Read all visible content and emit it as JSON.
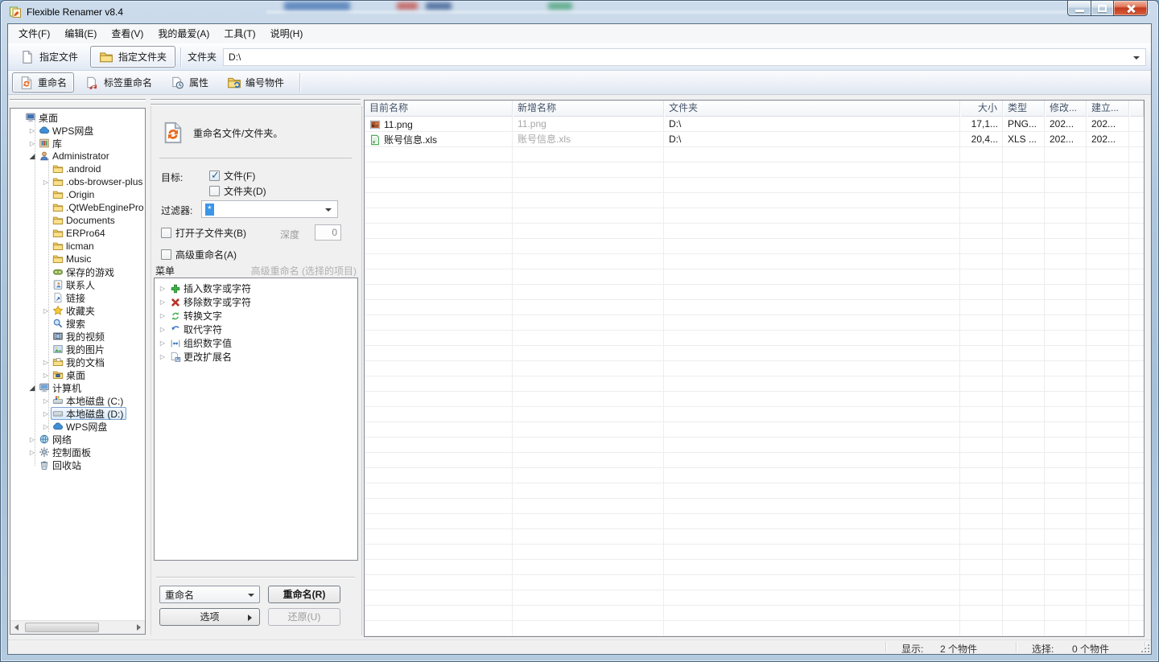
{
  "colors": {
    "titlebar": "#b7cde2",
    "selection_border": "#7da2ce",
    "selection_fill": "#d7e9fa",
    "header_text": "#44546a",
    "muted_text": "#a8a8a8",
    "filter_highlight": "#3b95e8"
  },
  "window": {
    "title": "Flexible Renamer v8.4",
    "controls": [
      {
        "name": "minimize",
        "label": "minimize"
      },
      {
        "name": "maximize",
        "label": "maximize"
      },
      {
        "name": "close",
        "label": "close"
      }
    ]
  },
  "menu_bar": {
    "items": [
      {
        "name": "file",
        "label": "文件(F)"
      },
      {
        "name": "edit",
        "label": "编辑(E)"
      },
      {
        "name": "view",
        "label": "查看(V)"
      },
      {
        "name": "favorites",
        "label": "我的最爱(A)"
      },
      {
        "name": "tools",
        "label": "工具(T)"
      },
      {
        "name": "help",
        "label": "说明(H)"
      }
    ]
  },
  "tab_bar": {
    "tabs": [
      {
        "name": "specify-file",
        "label": "指定文件",
        "icon": "file-icon",
        "selected": false
      },
      {
        "name": "specify-folder",
        "label": "指定文件夹",
        "icon": "folder-icon",
        "selected": true
      }
    ],
    "folder_label": "文件夹",
    "folder_value": "D:\\"
  },
  "toolbar": {
    "buttons": [
      {
        "name": "rename",
        "label": "重命名",
        "icon": "rename-icon",
        "selected": true
      },
      {
        "name": "tag-rename",
        "label": "标签重命名",
        "icon": "tag-rename-icon",
        "selected": false
      },
      {
        "name": "properties",
        "label": "属性",
        "icon": "properties-icon",
        "selected": false
      },
      {
        "name": "number-items",
        "label": "编号物件",
        "icon": "number-items-icon",
        "selected": false
      }
    ]
  },
  "folder_tree": {
    "items": [
      {
        "label": "桌面",
        "icon": "desktop-icon",
        "level": 0,
        "expander": "none",
        "selected": false
      },
      {
        "label": "WPS网盘",
        "icon": "cloud-icon",
        "level": 1,
        "expander": "collapsed",
        "selected": false
      },
      {
        "label": "库",
        "icon": "library-icon",
        "level": 1,
        "expander": "collapsed",
        "selected": false
      },
      {
        "label": "Administrator",
        "icon": "user-icon",
        "level": 1,
        "expander": "expanded",
        "selected": false
      },
      {
        "label": ".android",
        "icon": "folder-icon",
        "level": 2,
        "expander": "none",
        "selected": false
      },
      {
        "label": ".obs-browser-plus",
        "icon": "folder-icon",
        "level": 2,
        "expander": "collapsed",
        "selected": false
      },
      {
        "label": ".Origin",
        "icon": "folder-icon",
        "level": 2,
        "expander": "none",
        "selected": false
      },
      {
        "label": ".QtWebEnginePro",
        "icon": "folder-icon",
        "level": 2,
        "expander": "none",
        "selected": false
      },
      {
        "label": "Documents",
        "icon": "folder-icon",
        "level": 2,
        "expander": "none",
        "selected": false
      },
      {
        "label": "ERPro64",
        "icon": "folder-icon",
        "level": 2,
        "expander": "none",
        "selected": false
      },
      {
        "label": "licman",
        "icon": "folder-icon",
        "level": 2,
        "expander": "none",
        "selected": false
      },
      {
        "label": "Music",
        "icon": "folder-icon",
        "level": 2,
        "expander": "none",
        "selected": false
      },
      {
        "label": "保存的游戏",
        "icon": "saved-games-icon",
        "level": 2,
        "expander": "none",
        "selected": false
      },
      {
        "label": "联系人",
        "icon": "contacts-icon",
        "level": 2,
        "expander": "none",
        "selected": false
      },
      {
        "label": "链接",
        "icon": "links-icon",
        "level": 2,
        "expander": "none",
        "selected": false
      },
      {
        "label": "收藏夹",
        "icon": "favorites-icon",
        "level": 2,
        "expander": "collapsed",
        "selected": false
      },
      {
        "label": "搜索",
        "icon": "search-icon",
        "level": 2,
        "expander": "none",
        "selected": false
      },
      {
        "label": "我的视频",
        "icon": "videos-icon",
        "level": 2,
        "expander": "none",
        "selected": false
      },
      {
        "label": "我的图片",
        "icon": "pictures-icon",
        "level": 2,
        "expander": "none",
        "selected": false
      },
      {
        "label": "我的文档",
        "icon": "documents-icon",
        "level": 2,
        "expander": "collapsed",
        "selected": false
      },
      {
        "label": "桌面",
        "icon": "desktop-folder-icon",
        "level": 2,
        "expander": "collapsed",
        "selected": false
      },
      {
        "label": "计算机",
        "icon": "computer-icon",
        "level": 1,
        "expander": "expanded",
        "selected": false
      },
      {
        "label": "本地磁盘 (C:)",
        "icon": "disk-c-icon",
        "level": 2,
        "expander": "collapsed",
        "selected": false
      },
      {
        "label": "本地磁盘 (D:)",
        "icon": "disk-icon",
        "level": 2,
        "expander": "collapsed",
        "selected": true
      },
      {
        "label": "WPS网盘",
        "icon": "cloud-icon",
        "level": 2,
        "expander": "collapsed",
        "selected": false
      },
      {
        "label": "网络",
        "icon": "network-icon",
        "level": 1,
        "expander": "collapsed",
        "selected": false
      },
      {
        "label": "控制面板",
        "icon": "control-panel-icon",
        "level": 1,
        "expander": "collapsed",
        "selected": false
      },
      {
        "label": "回收站",
        "icon": "recycle-bin-icon",
        "level": 1,
        "expander": "none",
        "selected": false
      }
    ]
  },
  "rename_panel": {
    "header": "重命名文件/文件夹。",
    "target_label": "目标:",
    "checkboxes": [
      {
        "name": "target-files",
        "label": "文件(F)",
        "checked": true
      },
      {
        "name": "target-folders",
        "label": "文件夹(D)",
        "checked": false
      }
    ],
    "filter_label": "过滤器:",
    "filter_value": "*",
    "subfolder_checkbox": "打开子文件夹(B)",
    "depth_label": "深度",
    "depth_value": "0",
    "advanced_checkbox": "高级重命名(A)",
    "menu_label": "菜单",
    "advanced_hint": "高级重命名 (选择的项目)",
    "menu_items": [
      {
        "label": "插入数字或字符",
        "icon": "insert-icon"
      },
      {
        "label": "移除数字或字符",
        "icon": "remove-icon"
      },
      {
        "label": "转换文字",
        "icon": "convert-icon"
      },
      {
        "label": "取代字符",
        "icon": "replace-icon"
      },
      {
        "label": "组织数字值",
        "icon": "organize-icon"
      },
      {
        "label": "更改扩展名",
        "icon": "extension-icon"
      }
    ],
    "action_dropdown": "重命名",
    "rename_button": "重命名(R)",
    "options_button": "选项",
    "undo_button": "还原(U)"
  },
  "file_list": {
    "columns": [
      {
        "label": "目前名称",
        "align": "left"
      },
      {
        "label": "新增名称",
        "align": "left"
      },
      {
        "label": "文件夹",
        "align": "left"
      },
      {
        "label": "大小",
        "align": "right"
      },
      {
        "label": "类型",
        "align": "left"
      },
      {
        "label": "修改...",
        "align": "left"
      },
      {
        "label": "建立...",
        "align": "left"
      }
    ],
    "rows": [
      {
        "icon": "png-file-icon",
        "current": "11.png",
        "new": "11.png",
        "folder": "D:\\",
        "size": "17,1...",
        "type": "PNG...",
        "modified": "202...",
        "created": "202..."
      },
      {
        "icon": "xls-file-icon",
        "current": "账号信息.xls",
        "new": "账号信息.xls",
        "folder": "D:\\",
        "size": "20,4...",
        "type": "XLS ...",
        "modified": "202...",
        "created": "202..."
      }
    ]
  },
  "status_bar": {
    "display_label": "显示:",
    "display_value": "2 个物件",
    "select_label": "选择:",
    "select_value": "0 个物件"
  }
}
